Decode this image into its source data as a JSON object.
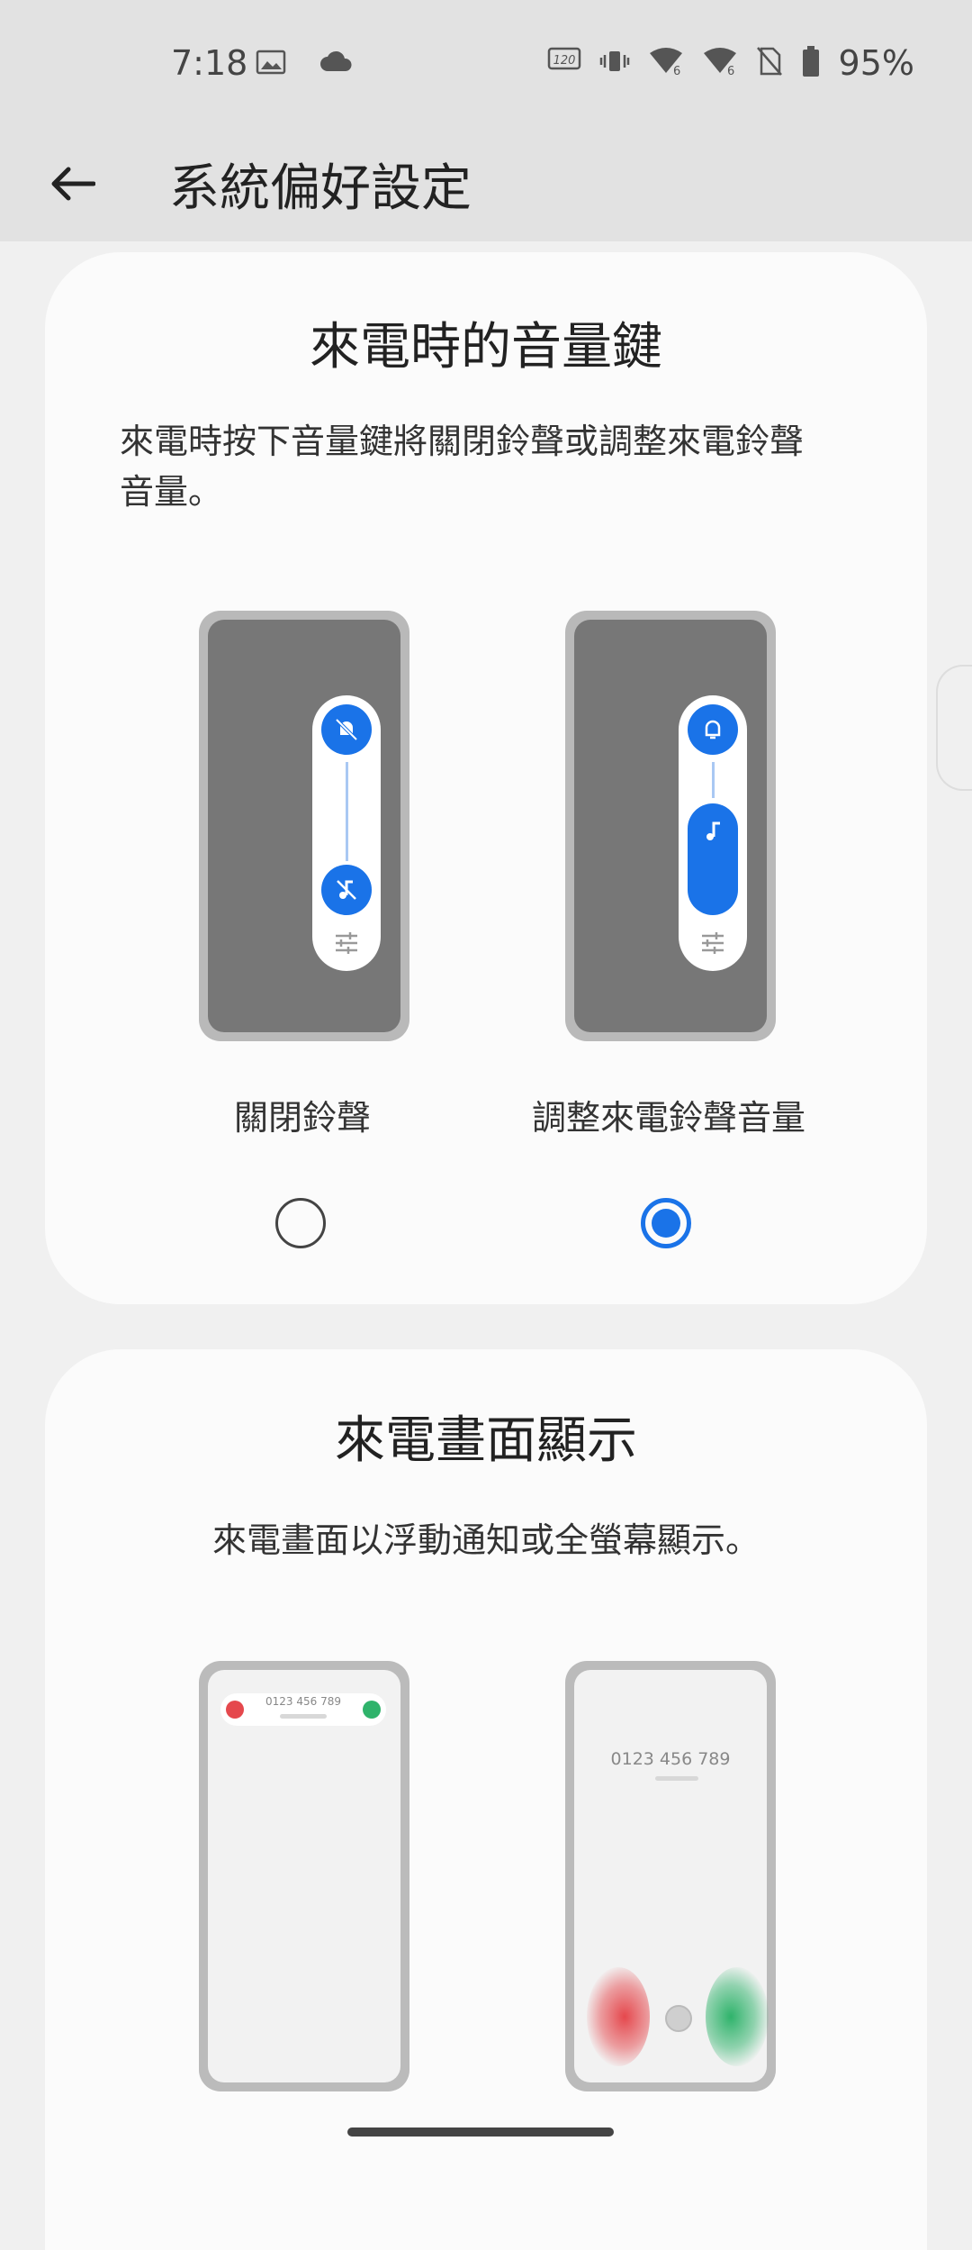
{
  "status_bar": {
    "time": "7:18",
    "battery": "95%",
    "refresh_badge": "120Hz",
    "signal_label": "6"
  },
  "app_bar": {
    "title": "系統偏好設定"
  },
  "volume_key_card": {
    "title": "來電時的音量鍵",
    "description_line1": "來電時按下音量鍵將關閉鈴聲或調整來電鈴聲",
    "description_line2": "音量。",
    "options": [
      {
        "label": "關閉鈴聲",
        "selected": false
      },
      {
        "label": "調整來電鈴聲音量",
        "selected": true
      }
    ]
  },
  "incoming_display_card": {
    "title": "來電畫面顯示",
    "description": "來電畫面以浮動通知或全螢幕顯示。",
    "preview_number": "0123 456 789"
  },
  "colors": {
    "accent": "#1a73e8",
    "decline": "#e5484d",
    "accept": "#2fb36b"
  }
}
